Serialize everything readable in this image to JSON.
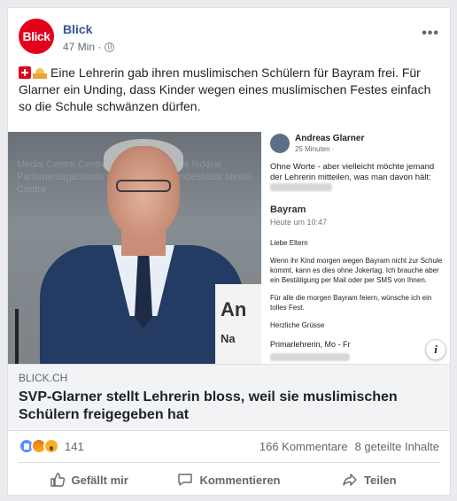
{
  "post": {
    "author": "Blick",
    "avatar_text": "Blick",
    "time": "47 Min ·",
    "audience_icon": "globe-icon",
    "more_icon": "more-options-icon",
    "more_label": "•••",
    "text": "Eine Lehrerin gab ihren muslimischen Schülern für Bayram frei. Für Glarner ein Unding, dass Kinder wegen eines muslimischen Festes einfach so die Schule schwänzen dürfen.",
    "emoji": [
      "swiss-flag-icon",
      "mosque-icon"
    ]
  },
  "media": {
    "photo_bg_text": "Media Centre  Centre des médias  Palais fédéral  Parlamentsgebäude  Centro media  Bundeshaus  Media Centre",
    "nameplate_top": "An",
    "nameplate_bottom": "Na",
    "screenshot": {
      "name": "Andreas Glarner",
      "time": "25 Minuten · ",
      "intro": "Ohne Worte - aber vielleicht möchte jemand der Lehrerin mitteilen, was man davon hält:",
      "title": "Bayram",
      "subtitle": "Heute um 10:47",
      "body": [
        "Liebe Eltern",
        "Wenn ihr Kind morgen wegen Bayram nicht zur Schule kommt, kann es dies ohne Jokertag. Ich brauche aber ein Bestätigung per Mail oder per SMS von Ihnen.",
        "Für alle die morgen Bayram feiern, wünsche ich ein tolles Fest.",
        "Herzliche Grüsse"
      ],
      "signature": "Primarlehrerin, Mo - Fr"
    },
    "info_label": "i"
  },
  "link": {
    "domain": "BLICK.CH",
    "title": "SVP-Glarner stellt Lehrerin bloss, weil sie muslimischen Schülern freigegeben hat"
  },
  "counts": {
    "reactions": [
      "like",
      "angry",
      "wow"
    ],
    "reaction_count": "141",
    "comments": "166 Kommentare",
    "shares": "8 geteilte Inhalte"
  },
  "actions": {
    "like": "Gefällt mir",
    "comment": "Kommentieren",
    "share": "Teilen"
  },
  "colors": {
    "brand_red": "#e2001a",
    "link_blue": "#385898",
    "text_gray": "#606770"
  }
}
